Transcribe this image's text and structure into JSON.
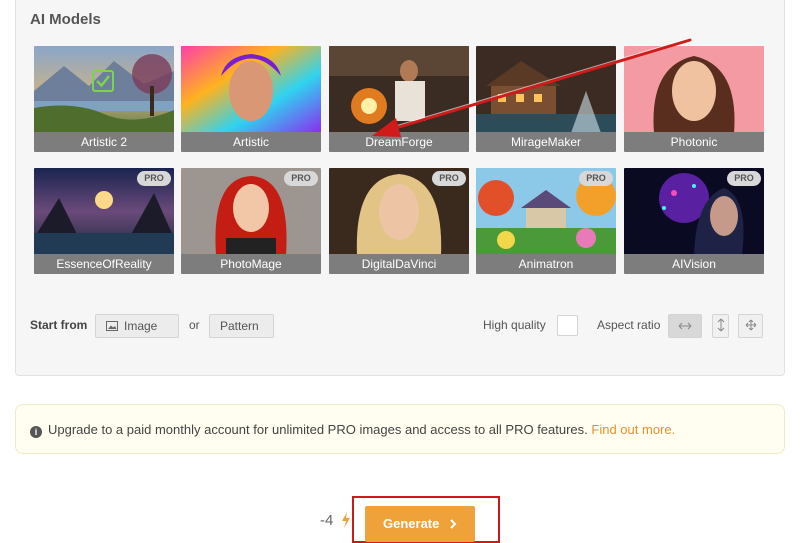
{
  "ai_models": {
    "title": "AI Models",
    "models": [
      {
        "name": "Artistic 2",
        "pro": false,
        "selected": true
      },
      {
        "name": "Artistic",
        "pro": false
      },
      {
        "name": "DreamForge",
        "pro": false
      },
      {
        "name": "MirageMaker",
        "pro": false
      },
      {
        "name": "Photonic",
        "pro": false
      },
      {
        "name": "EssenceOfReality",
        "pro": true
      },
      {
        "name": "PhotoMage",
        "pro": true
      },
      {
        "name": "DigitalDaVinci",
        "pro": true
      },
      {
        "name": "Animatron",
        "pro": true
      },
      {
        "name": "AIVision",
        "pro": true
      }
    ],
    "pro_badge": "PRO"
  },
  "start_from": {
    "label": "Start from",
    "image_label": "Image",
    "or_label": "or",
    "pattern_label": "Pattern"
  },
  "options": {
    "high_quality_label": "High quality",
    "aspect_ratio_label": "Aspect ratio"
  },
  "notice": {
    "text": "Upgrade to a paid monthly account for unlimited PRO images and access to all PRO features.",
    "link": "Find out more."
  },
  "generate": {
    "cost": "-4",
    "label": "Generate"
  },
  "colors": {
    "accent": "#f0a23a",
    "link": "#e8902a",
    "highlight_box": "#cc1a1a",
    "annotation_arrow": "#d11a1a"
  },
  "icons": {
    "selected": "check-icon",
    "image": "image-icon",
    "notice": "info-icon",
    "generate": "chevron-right-icon",
    "cost": "lightning-icon"
  }
}
